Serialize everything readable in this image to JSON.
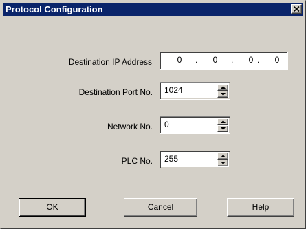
{
  "window": {
    "title": "Protocol Configuration",
    "close_icon": "close-x"
  },
  "form": {
    "destination_ip": {
      "label": "Destination IP Address",
      "octets": [
        "0",
        "0",
        "0",
        "0"
      ],
      "separator": "."
    },
    "destination_port": {
      "label": "Destination Port No.",
      "value": "1024"
    },
    "network": {
      "label": "Network No.",
      "value": "0"
    },
    "plc": {
      "label": "PLC No.",
      "value": "255"
    }
  },
  "buttons": {
    "ok": "OK",
    "cancel": "Cancel",
    "help": "Help"
  },
  "colors": {
    "titlebar": "#0a246a",
    "face": "#d4d0c8"
  }
}
